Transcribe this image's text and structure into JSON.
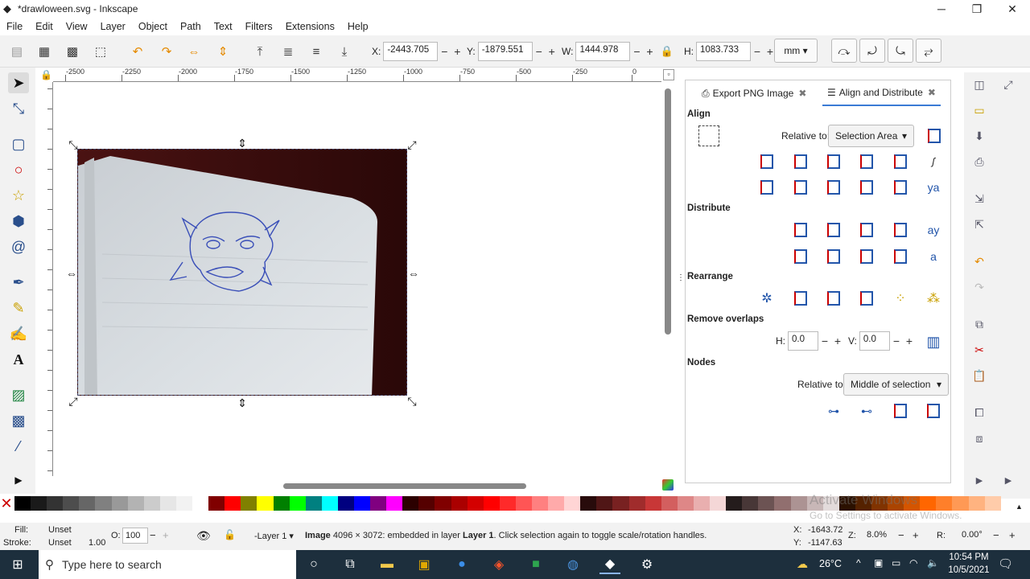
{
  "window": {
    "title": "*drawloween.svg - Inkscape",
    "minimize": "─",
    "maximize": "❐",
    "close": "✕"
  },
  "menu": [
    "File",
    "Edit",
    "View",
    "Layer",
    "Object",
    "Path",
    "Text",
    "Filters",
    "Extensions",
    "Help"
  ],
  "toolbar": {
    "x_label": "X:",
    "x_value": "-2443.705",
    "y_label": "Y:",
    "y_value": "-1879.551",
    "w_label": "W:",
    "w_value": "1444.978",
    "h_label": "H:",
    "h_value": "1083.733",
    "unit": "mm",
    "minus": "−",
    "plus": "+"
  },
  "ruler": {
    "labels": [
      "-2500",
      "-2250",
      "-2000",
      "-1750",
      "-1500",
      "-1250",
      "-1000",
      "-750",
      "-500",
      "-250",
      "0"
    ]
  },
  "dock": {
    "tab_export": "Export PNG Image",
    "tab_align": "Align and Distribute",
    "align_title": "Align",
    "relative_to_label": "Relative to:",
    "relative_to_value": "Selection Area",
    "distribute_title": "Distribute",
    "rearrange_title": "Rearrange",
    "remove_overlaps_title": "Remove overlaps",
    "h_label": "H:",
    "h_value": "0.0",
    "v_label": "V:",
    "v_value": "0.0",
    "nodes_title": "Nodes",
    "nodes_relative_label": "Relative to:",
    "nodes_relative_value": "Middle of selection",
    "ya_text": "ya",
    "ay_text": "ay",
    "a_text": "a"
  },
  "status": {
    "fill_label": "Fill:",
    "fill_value": "Unset",
    "stroke_label": "Stroke:",
    "stroke_value": "Unset",
    "stroke_width": "1.00",
    "opacity_label": "O:",
    "opacity_value": "100",
    "layer": "-Layer 1",
    "message_bold": "Image",
    "message": "4096 × 3072: embedded in layer",
    "message_layer": "Layer 1",
    "message_tail": ". Click selection again to toggle scale/rotation handles.",
    "x_label": "X:",
    "x_value": "-1643.72",
    "y_label": "Y:",
    "y_value": "-1147.63",
    "z_label": "Z:",
    "zoom": "8.0%",
    "r_label": "R:",
    "rotation": "0.00°"
  },
  "watermark": {
    "line1": "Activate Windows",
    "line2": "Go to Settings to activate Windows."
  },
  "taskbar": {
    "search_placeholder": "Type here to search",
    "temperature": "26°C",
    "time": "10:54 PM",
    "date": "10/5/2021"
  },
  "palette_colors": [
    "#000000",
    "#1a1a1a",
    "#333333",
    "#4d4d4d",
    "#666666",
    "#808080",
    "#999999",
    "#b3b3b3",
    "#cccccc",
    "#e6e6e6",
    "#f2f2f2",
    "#ffffff",
    "#800000",
    "#ff0000",
    "#808000",
    "#ffff00",
    "#008000",
    "#00ff00",
    "#008080",
    "#00ffff",
    "#000080",
    "#0000ff",
    "#800080",
    "#ff00ff",
    "#2b0000",
    "#550000",
    "#800000",
    "#aa0000",
    "#d40000",
    "#ff0000",
    "#ff2a2a",
    "#ff5555",
    "#ff8080",
    "#ffaaaa",
    "#ffd5d5",
    "#280b0b",
    "#501616",
    "#782121",
    "#a02c2c",
    "#c83737",
    "#d35f5f",
    "#de8787",
    "#e9afaf",
    "#f4d7d7",
    "#241c1c",
    "#483737",
    "#6c5353",
    "#916f6f",
    "#ac9393",
    "#c8b7b7",
    "#e3dbdb",
    "#2b1100",
    "#552200",
    "#803300",
    "#aa4400",
    "#d45500",
    "#ff6600",
    "#ff7f2a",
    "#ff9955",
    "#ffb380",
    "#ffccaa"
  ]
}
